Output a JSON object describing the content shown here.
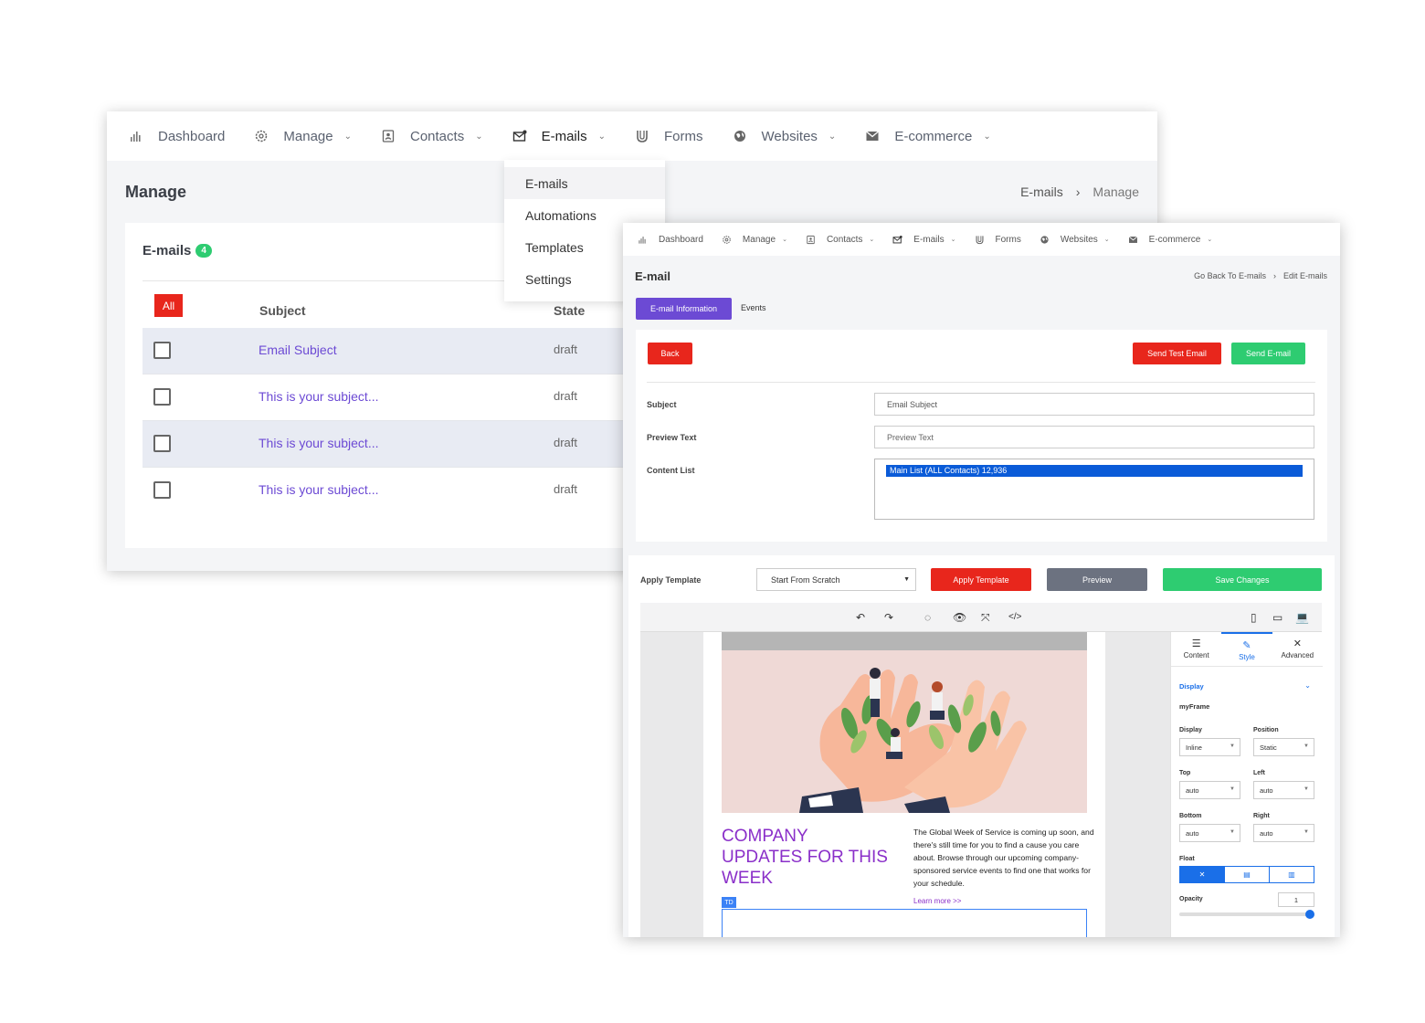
{
  "back_window": {
    "nav": [
      {
        "label": "Dashboard",
        "icon": "bar-chart-icon",
        "has_chevron": false
      },
      {
        "label": "Manage",
        "icon": "gear-icon",
        "has_chevron": true
      },
      {
        "label": "Contacts",
        "icon": "contact-card-icon",
        "has_chevron": true
      },
      {
        "label": "E-mails",
        "icon": "mail-icon",
        "has_chevron": true,
        "active": true
      },
      {
        "label": "Forms",
        "icon": "magnet-icon",
        "has_chevron": false
      },
      {
        "label": "Websites",
        "icon": "globe-icon",
        "has_chevron": true
      },
      {
        "label": "E-commerce",
        "icon": "envelope-icon",
        "has_chevron": true
      }
    ],
    "page_title": "Manage",
    "breadcrumb": [
      "E-mails",
      "Manage"
    ],
    "card": {
      "title": "E-mails",
      "count": "4",
      "all_button": "All",
      "columns": {
        "subject": "Subject",
        "state": "State"
      },
      "rows": [
        {
          "subject": "Email Subject",
          "state": "draft"
        },
        {
          "subject": "This is your subject...",
          "state": "draft"
        },
        {
          "subject": "This is your subject...",
          "state": "draft"
        },
        {
          "subject": "This is your subject...",
          "state": "draft"
        }
      ]
    },
    "dropdown": [
      "E-mails",
      "Automations",
      "Templates",
      "Settings"
    ]
  },
  "front_window": {
    "nav": [
      {
        "label": "Dashboard",
        "icon": "bar-chart-icon",
        "has_chevron": false
      },
      {
        "label": "Manage",
        "icon": "gear-icon",
        "has_chevron": true
      },
      {
        "label": "Contacts",
        "icon": "contact-card-icon",
        "has_chevron": true
      },
      {
        "label": "E-mails",
        "icon": "mail-icon",
        "has_chevron": true
      },
      {
        "label": "Forms",
        "icon": "magnet-icon",
        "has_chevron": false
      },
      {
        "label": "Websites",
        "icon": "globe-icon",
        "has_chevron": true
      },
      {
        "label": "E-commerce",
        "icon": "envelope-icon",
        "has_chevron": true
      }
    ],
    "title": "E-mail",
    "breadcrumb": [
      "Go Back To E-mails",
      "Edit E-mails"
    ],
    "tabs": {
      "active": "E-mail Information",
      "other": "Events"
    },
    "buttons": {
      "back": "Back",
      "send_test": "Send Test Email",
      "send": "Send E-mail"
    },
    "form": {
      "subject_label": "Subject",
      "subject_value": "Email Subject",
      "preview_label": "Preview Text",
      "preview_placeholder": "Preview Text",
      "content_list_label": "Content List",
      "content_list_selected": "Main List (ALL Contacts) 12,936"
    },
    "template_bar": {
      "label": "Apply Template",
      "select_value": "Start From Scratch",
      "apply": "Apply Template",
      "preview": "Preview",
      "save": "Save Changes"
    },
    "email_canvas": {
      "headline": "COMPANY UPDATES FOR THIS WEEK",
      "body": "The Global Week of Service is coming up soon, and there's still time for you to find a cause you care about. Browse through our upcoming company-sponsored service events to find one that works for your schedule.",
      "link": "Learn more >>",
      "td_tag": "TD"
    },
    "style_panel": {
      "tabs": [
        "Content",
        "Style",
        "Advanced"
      ],
      "section": "Display",
      "element_name": "myFrame",
      "fields": {
        "display_label": "Display",
        "display_value": "Inline",
        "position_label": "Position",
        "position_value": "Static",
        "top_label": "Top",
        "top_value": "auto",
        "left_label": "Left",
        "left_value": "auto",
        "bottom_label": "Bottom",
        "bottom_value": "auto",
        "right_label": "Right",
        "right_value": "auto",
        "float_label": "Float",
        "opacity_label": "Opacity",
        "opacity_value": "1"
      }
    }
  },
  "colors": {
    "accent_purple": "#6c4ad4",
    "danger_red": "#e8261c",
    "success_green": "#2ecc71",
    "primary_blue": "#1a6fe8"
  }
}
